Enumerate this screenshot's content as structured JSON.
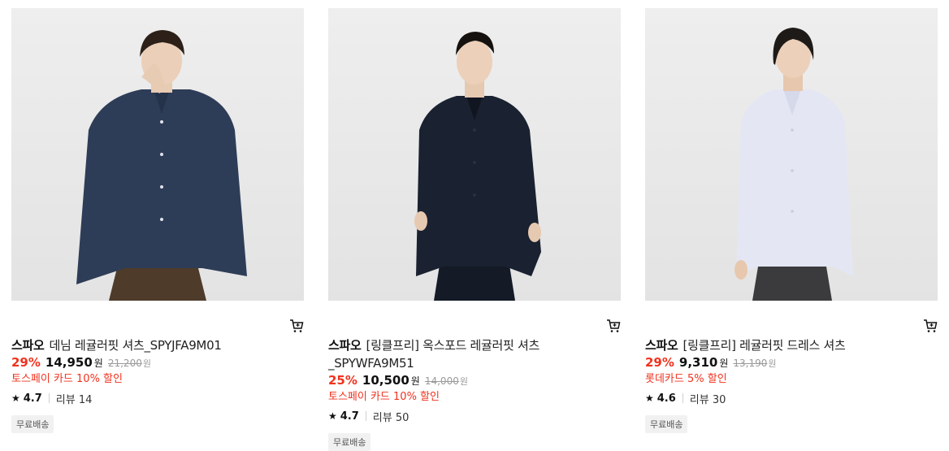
{
  "products": [
    {
      "brand": "스파오",
      "name": "데님 레귤러핏 셔츠_SPYJFA9M01",
      "rate": "29%",
      "price": "14,950",
      "won": "원",
      "original_price": "21,200",
      "original_won": "원",
      "promo": "토스페이 카드 10% 할인",
      "rating": "4.7",
      "review": "리뷰 14",
      "badge": "무료배송",
      "image": {
        "shirt_color": "#2e3d57",
        "pants_color": "#4f3b2a"
      }
    },
    {
      "brand": "스파오",
      "name": "[링클프리] 옥스포드 레귤러핏 셔츠_SPYWFA9M51",
      "rate": "25%",
      "price": "10,500",
      "won": "원",
      "original_price": "14,000",
      "original_won": "원",
      "promo": "토스페이 카드 10% 할인",
      "rating": "4.7",
      "review": "리뷰 50",
      "badge": "무료배송",
      "image": {
        "shirt_color": "#1a2130",
        "pants_color": "#141a26"
      }
    },
    {
      "brand": "스파오",
      "name": "[링클프리] 레귤러핏 드레스 셔츠",
      "rate": "29%",
      "price": "9,310",
      "won": "원",
      "original_price": "13,190",
      "original_won": "원",
      "promo": "롯데카드 5% 할인",
      "rating": "4.6",
      "review": "리뷰 30",
      "badge": "무료배송",
      "image": {
        "shirt_color": "#e4e7f3",
        "pants_color": "#3b3b3d"
      }
    }
  ],
  "icons": {
    "cart": "cart-icon",
    "star": "star-icon"
  },
  "colors": {
    "discount": "#f0321e",
    "strike": "#9a9a9a"
  }
}
